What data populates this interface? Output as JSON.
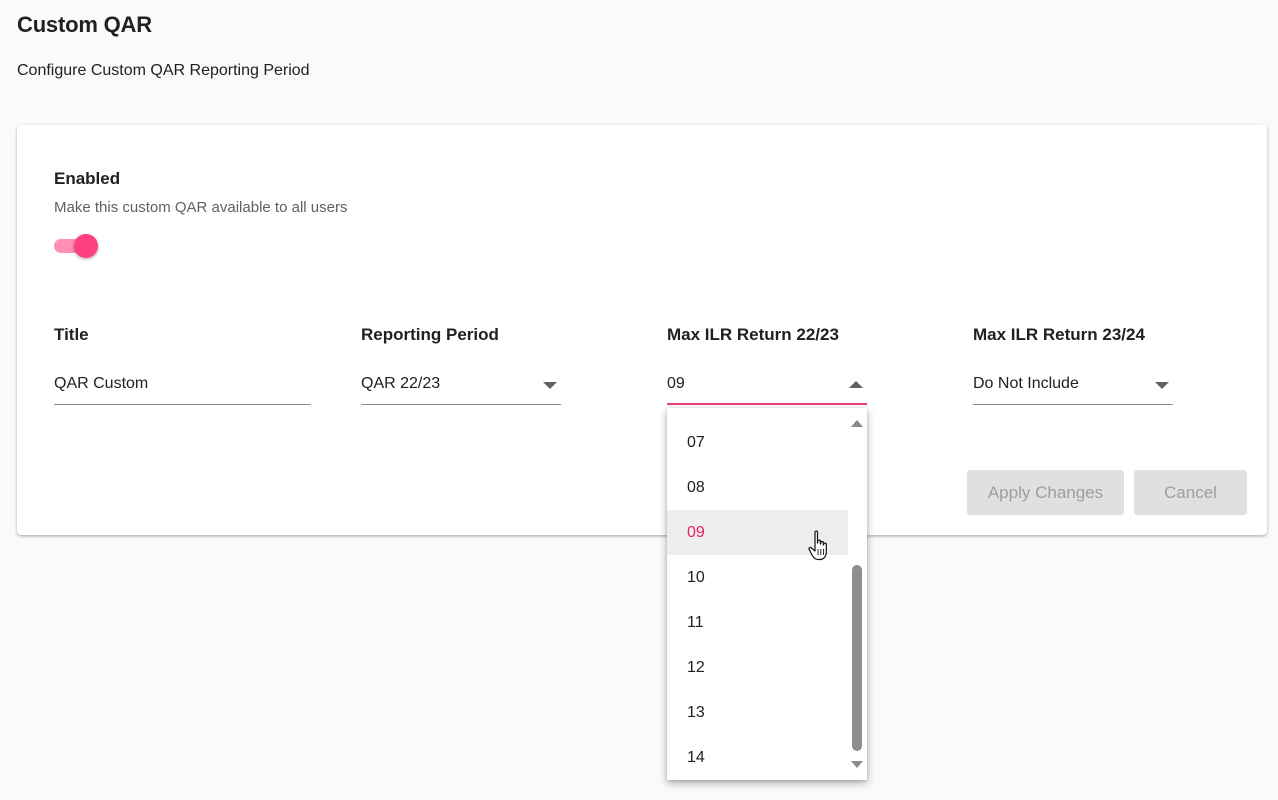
{
  "page": {
    "title": "Custom QAR",
    "subtitle": "Configure Custom QAR Reporting Period"
  },
  "enabled": {
    "label": "Enabled",
    "description": "Make this custom QAR available to all users",
    "on": true
  },
  "fields": {
    "title": {
      "label": "Title",
      "value": "QAR Custom"
    },
    "reporting_period": {
      "label": "Reporting Period",
      "value": "QAR 22/23"
    },
    "max_ilr_2223": {
      "label": "Max ILR Return 22/23",
      "value": "09"
    },
    "max_ilr_2324": {
      "label": "Max ILR Return 23/24",
      "value": "Do Not Include"
    }
  },
  "buttons": {
    "apply": "Apply Changes",
    "cancel": "Cancel"
  },
  "dropdown": {
    "options": [
      "07",
      "08",
      "09",
      "10",
      "11",
      "12",
      "13",
      "14"
    ],
    "selected": "09"
  },
  "icons": {
    "toggle": "toggle-switch-icon",
    "caret_down": "caret-down-icon",
    "caret_up": "caret-up-icon",
    "cursor": "hand-pointer-icon"
  },
  "colors": {
    "accent": "#ff4081",
    "accent_light": "#ff8fb3",
    "selected_text": "#e91e63",
    "focus_underline": "#ec407a",
    "button_disabled_bg": "#e0e0e0",
    "button_disabled_text": "#9e9e9e"
  }
}
